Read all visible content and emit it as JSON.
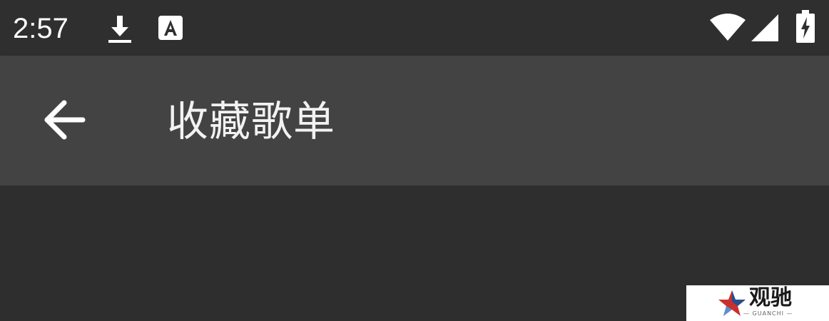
{
  "status_bar": {
    "time": "2:57",
    "icons": [
      "download-icon",
      "a-notification-icon",
      "wifi-icon",
      "cell-signal-icon",
      "battery-charging-icon"
    ]
  },
  "app_bar": {
    "title": "收藏歌单",
    "back_icon": "arrow-back-icon"
  },
  "watermark": {
    "text": "观驰",
    "sub": "— GUANCHI —"
  },
  "colors": {
    "status_bar_bg": "#2f2f2f",
    "app_bar_bg": "#434343",
    "content_bg": "#2e2e2e",
    "text": "#ffffff"
  }
}
